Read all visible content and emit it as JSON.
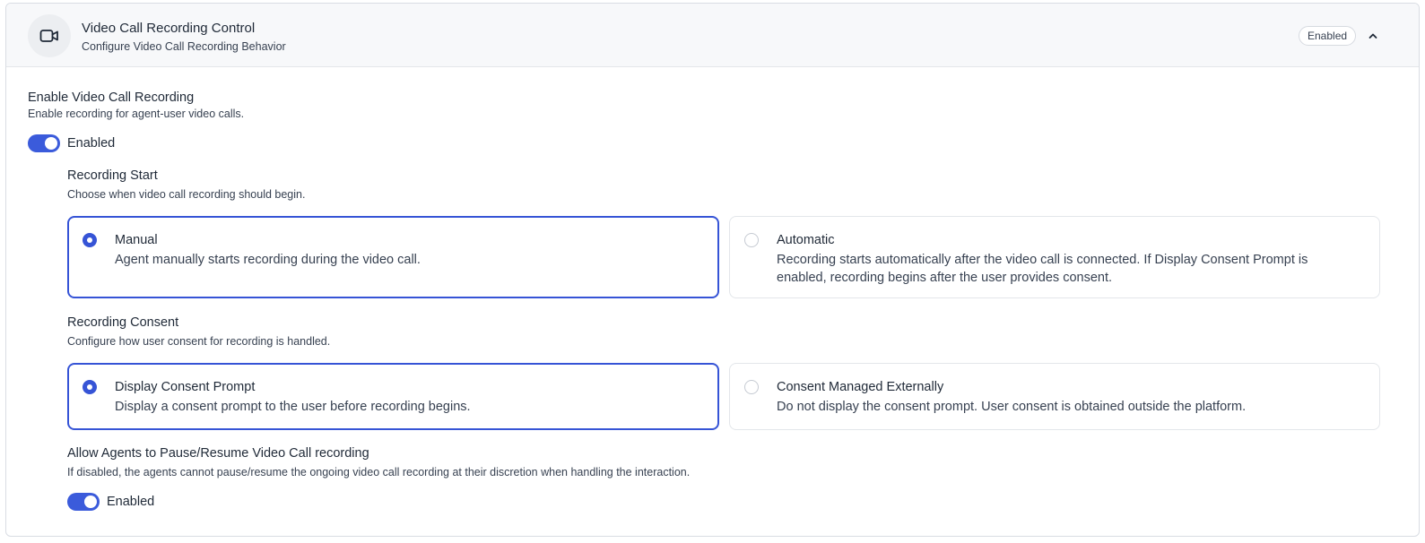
{
  "header": {
    "icon": "video-camera-icon",
    "title": "Video Call Recording Control",
    "subtitle": "Configure Video Call Recording Behavior",
    "status": "Enabled",
    "collapse_icon": "chevron-up-icon"
  },
  "enable_recording": {
    "label": "Enable Video Call Recording",
    "description": "Enable recording for agent-user video calls.",
    "toggle_on": true,
    "toggle_label": "Enabled"
  },
  "recording_start": {
    "label": "Recording Start",
    "description": "Choose when video call recording should begin.",
    "selected": "Manual",
    "options": [
      {
        "title": "Manual",
        "description": "Agent manually starts recording during the video call."
      },
      {
        "title": "Automatic",
        "description": "Recording starts automatically after the video call is connected. If Display Consent Prompt is enabled, recording begins after the user provides consent."
      }
    ]
  },
  "recording_consent": {
    "label": "Recording Consent",
    "description": "Configure how user consent for recording is handled.",
    "selected": "Display Consent Prompt",
    "options": [
      {
        "title": "Display Consent Prompt",
        "description": "Display a consent prompt to the user before recording begins."
      },
      {
        "title": "Consent Managed Externally",
        "description": "Do not display the consent prompt. User consent is obtained outside the platform."
      }
    ]
  },
  "pause_resume": {
    "label": "Allow Agents to Pause/Resume Video Call recording",
    "description": "If disabled, the agents cannot pause/resume the ongoing video call recording at their discretion when handling the interaction.",
    "toggle_on": true,
    "toggle_label": "Enabled"
  },
  "colors": {
    "accent": "#3654d6",
    "toggle": "#3b5bdb"
  }
}
